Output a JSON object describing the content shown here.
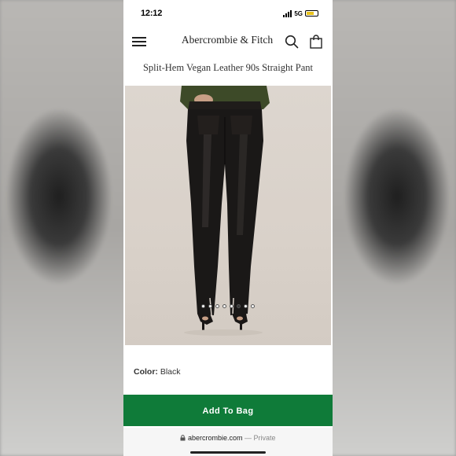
{
  "status_bar": {
    "time": "12:12",
    "network": "5G"
  },
  "header": {
    "brand": "Abercrombie & Fitch"
  },
  "product": {
    "title": "Split-Hem Vegan Leather 90s Straight Pant",
    "image_count": 8,
    "active_image_index": 5,
    "color_label": "Color:",
    "color_value": "Black"
  },
  "actions": {
    "add_to_bag": "Add To Bag"
  },
  "browser": {
    "url": "abercrombie.com",
    "privacy": "— Private"
  },
  "colors": {
    "accent_green": "#0f7b39",
    "pants": "#1a1817",
    "top": "#3d4a28"
  },
  "icons": [
    "menu-icon",
    "search-icon",
    "bag-icon",
    "lock-icon"
  ]
}
